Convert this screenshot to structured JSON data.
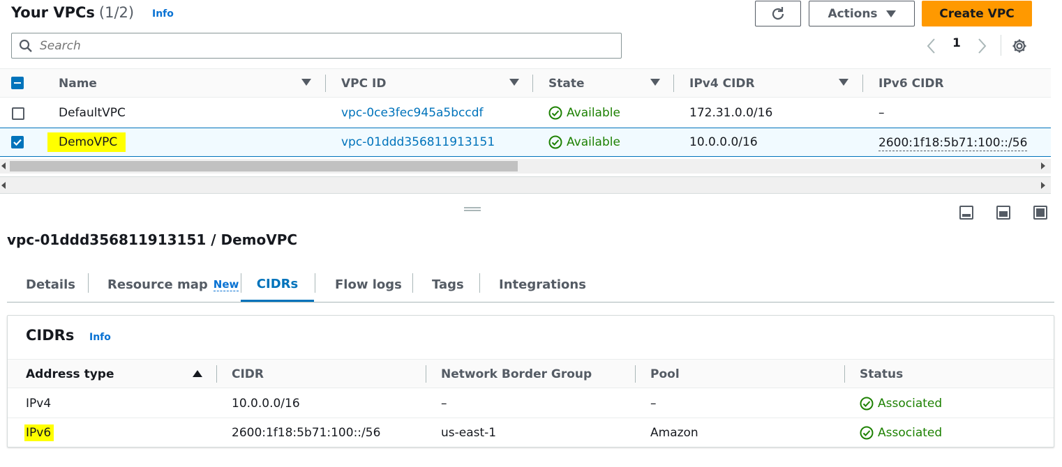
{
  "header": {
    "title": "Your VPCs",
    "count": "(1/2)",
    "info": "Info",
    "actions_label": "Actions",
    "create_label": "Create VPC",
    "search_placeholder": "Search",
    "page": "1"
  },
  "vpc_table": {
    "columns": [
      "Name",
      "VPC ID",
      "State",
      "IPv4 CIDR",
      "IPv6 CIDR"
    ],
    "rows": [
      {
        "name": "DefaultVPC",
        "vpc_id": "vpc-0ce3fec945a5bccdf",
        "state": "Available",
        "ipv4": "172.31.0.0/16",
        "ipv6": "–",
        "selected": false
      },
      {
        "name": "DemoVPC",
        "vpc_id": "vpc-01ddd356811913151",
        "state": "Available",
        "ipv4": "10.0.0.0/16",
        "ipv6": "2600:1f18:5b71:100::/56",
        "selected": true
      }
    ]
  },
  "detail": {
    "title": "vpc-01ddd356811913151 / DemoVPC",
    "tabs": [
      {
        "label": "Details"
      },
      {
        "label": "Resource map",
        "badge": "New"
      },
      {
        "label": "CIDRs",
        "active": true
      },
      {
        "label": "Flow logs"
      },
      {
        "label": "Tags"
      },
      {
        "label": "Integrations"
      }
    ]
  },
  "cidrs": {
    "title": "CIDRs",
    "info": "Info",
    "columns": [
      "Address type",
      "CIDR",
      "Network Border Group",
      "Pool",
      "Status"
    ],
    "rows": [
      {
        "type": "IPv4",
        "cidr": "10.0.0.0/16",
        "nbg": "–",
        "pool": "–",
        "status": "Associated"
      },
      {
        "type": "IPv6",
        "cidr": "2600:1f18:5b71:100::/56",
        "nbg": "us-east-1",
        "pool": "Amazon",
        "status": "Associated"
      }
    ]
  },
  "colors": {
    "primary": "#ff9900",
    "link": "#0073bb",
    "success": "#1d8102",
    "highlight": "#ffff00"
  }
}
